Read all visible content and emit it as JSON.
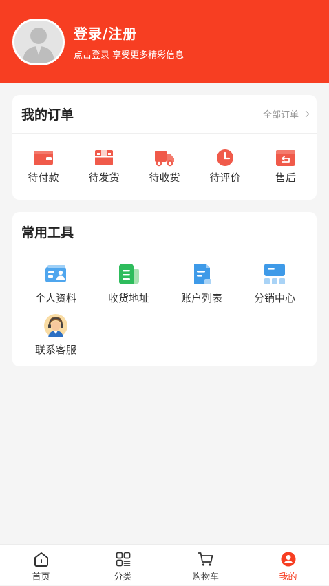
{
  "header": {
    "title": "登录/注册",
    "subtitle": "点击登录 享受更多精彩信息",
    "color": "#f73e22"
  },
  "orders": {
    "title": "我的订单",
    "all_label": "全部订单",
    "items": [
      {
        "label": "待付款",
        "icon": "wallet-icon"
      },
      {
        "label": "待发货",
        "icon": "package-icon"
      },
      {
        "label": "待收货",
        "icon": "truck-icon"
      },
      {
        "label": "待评价",
        "icon": "clock-icon"
      },
      {
        "label": "售后",
        "icon": "return-box-icon"
      }
    ]
  },
  "tools": {
    "title": "常用工具",
    "items": [
      {
        "label": "个人资料",
        "icon": "id-card-icon"
      },
      {
        "label": "收货地址",
        "icon": "address-book-icon"
      },
      {
        "label": "账户列表",
        "icon": "document-list-icon"
      },
      {
        "label": "分销中心",
        "icon": "distribution-icon"
      },
      {
        "label": "联系客服",
        "icon": "customer-service-icon"
      }
    ]
  },
  "tabbar": {
    "active_color": "#f73e22",
    "items": [
      {
        "label": "首页",
        "icon": "home-icon"
      },
      {
        "label": "分类",
        "icon": "category-grid-icon"
      },
      {
        "label": "购物车",
        "icon": "cart-icon"
      },
      {
        "label": "我的",
        "icon": "profile-icon"
      }
    ]
  }
}
